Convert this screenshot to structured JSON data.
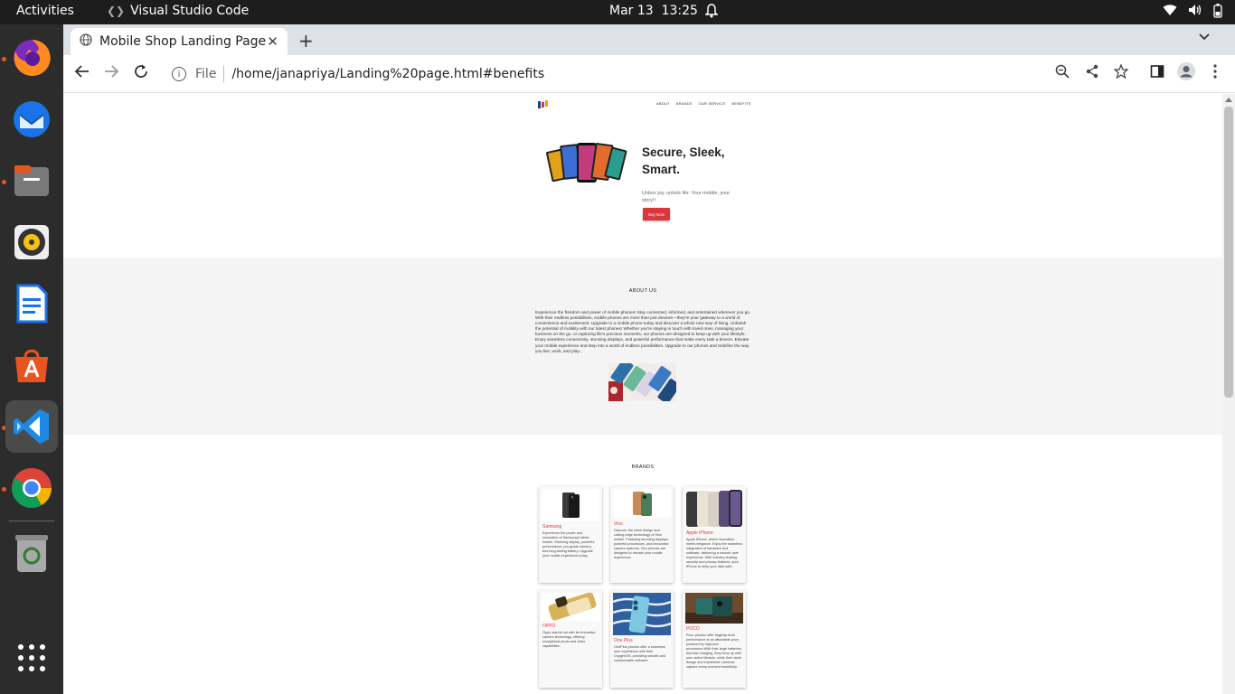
{
  "topbar": {
    "activities": "Activities",
    "app_name": "Visual Studio Code",
    "date": "Mar 13",
    "time": "13:25"
  },
  "dock": {
    "apps": [
      "firefox-icon",
      "thunderbird-icon",
      "files-icon",
      "rhythmbox-icon",
      "libreoffice-writer-icon",
      "app-center-icon",
      "vscode-icon",
      "chrome-icon",
      "trash-icon",
      "app-grid-icon"
    ]
  },
  "browser": {
    "tab_title": "Mobile Shop Landing Page",
    "scheme_label": "File",
    "url": "/home/janapriya/Landing%20page.html#benefits"
  },
  "site": {
    "nav": [
      "ABOUT",
      "BRANDS",
      "OUR SERVICE",
      "BENEFITS"
    ],
    "hero": {
      "title": "Secure, Sleek, Smart.",
      "subtitle": "Unbox joy, unlock life: Your mobile, your story!!",
      "button": "Buy Now"
    },
    "about": {
      "title": "ABOUT US",
      "text": "Experience the freedom and power of mobile phones! Stay connected, informed, and entertained wherever you go. With their endless possibilities, mobile phones are more than just devices—they're your gateway to a world of convenience and excitement. Upgrade to a mobile phone today and discover a whole new way of living. Unleash the potential of mobility with our latest phones! Whether you're staying in touch with loved ones, managing your business on the go, or capturing life's precious moments, our phones are designed to keep up with your lifestyle. Enjoy seamless connectivity, stunning displays, and powerful performance that make every task a breeze. Elevate your mobile experience and step into a world of endless possibilities. Upgrade to our phones and redefine the way you live, work, and play..."
    },
    "brands": {
      "title": "BRANDS",
      "cards": [
        {
          "name": "Samsung",
          "desc": "Experience the power and innovation of Samsung's latest mobile. Stunning display, powerful performance, pro-grade camera, and long-lasting battery. Upgrade your mobile experience today."
        },
        {
          "name": "Vivo",
          "desc": "Discover the sleek design and cutting-edge technology of Vivo mobile. Featuring stunning displays, powerful processors, and innovative camera systems, Vivo phones are designed to elevate your mobile experience."
        },
        {
          "name": "Apple iPhone",
          "desc": "Apple iPhone, where innovation meets elegance. Enjoy the seamless integration of hardware and software, delivering a smooth user experience. With industry-leading security and privacy features, your iPhone to keep your data safe..."
        },
        {
          "name": "OPPO",
          "desc": "Oppo stands out with its innovative camera technology, offering exceptional photo and video capabilities."
        },
        {
          "name": "One Plus",
          "desc": "OnePlus phones offer a seamless user experience with their OxygenOS, providing smooth and customizable software"
        },
        {
          "name": "POCO",
          "desc": "Poco phones offer flagship-level performance at an affordable price, powered by high-end processors.With their large batteries and fast charging, they keep up with your active lifestyle, while their sleek design and impressive cameras capture every moment beautifully."
        }
      ]
    }
  }
}
